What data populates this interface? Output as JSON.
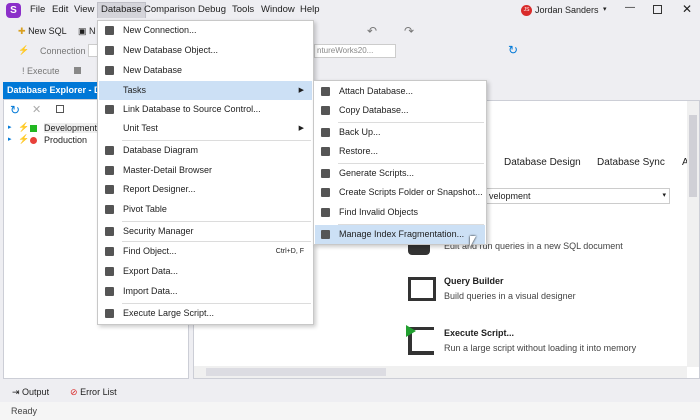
{
  "app": {
    "logo": "S",
    "menu": [
      "File",
      "Edit",
      "View",
      "Database",
      "Comparison",
      "Debug",
      "Tools",
      "Window",
      "Help"
    ],
    "user": {
      "initials": "JS",
      "name": "Jordan  Sanders"
    },
    "window_controls": [
      "minimize",
      "maximize",
      "close"
    ]
  },
  "toolbar": {
    "new_sql": "New SQL",
    "new_other": "N",
    "connection": "Connection",
    "database_combo": "ntureWorks20...",
    "execute": "Execute"
  },
  "explorer": {
    "title": "Database Explorer - De",
    "tree": [
      {
        "label": "Development",
        "status_color": "#22b822"
      },
      {
        "label": "Production",
        "status_color": "#e8413a"
      }
    ]
  },
  "main": {
    "tabs": [
      "Database Design",
      "Database Sync",
      "A"
    ],
    "connection_value": "velopment",
    "items": [
      {
        "title": "",
        "desc": "Edit and run queries in a new SQL document"
      },
      {
        "title": "Query Builder",
        "desc": "Build queries in a visual designer"
      },
      {
        "title": "Execute Script...",
        "desc": "Run a large script without loading it into memory"
      }
    ]
  },
  "database_menu": [
    {
      "label": "New Connection..."
    },
    {
      "label": "New Database Object..."
    },
    {
      "label": "New Database"
    },
    {
      "label": "Tasks",
      "submenu": true,
      "highlighted": true
    },
    {
      "label": "Link Database to Source Control..."
    },
    {
      "label": "Unit Test",
      "submenu": true
    },
    {
      "label": "Database Diagram"
    },
    {
      "label": "Master-Detail Browser"
    },
    {
      "label": "Report Designer..."
    },
    {
      "label": "Pivot Table"
    },
    {
      "label": "Security Manager"
    },
    {
      "label": "Find Object...",
      "shortcut": "Ctrl+D, F"
    },
    {
      "label": "Export Data..."
    },
    {
      "label": "Import Data..."
    },
    {
      "label": "Execute Large Script..."
    }
  ],
  "tasks_menu": [
    {
      "label": "Attach Database..."
    },
    {
      "label": "Copy Database..."
    },
    {
      "label": "Back Up..."
    },
    {
      "label": "Restore..."
    },
    {
      "label": "Generate Scripts..."
    },
    {
      "label": "Create Scripts Folder or Snapshot..."
    },
    {
      "label": "Find Invalid Objects"
    },
    {
      "label": "Manage Index Fragmentation...",
      "highlighted": true
    }
  ],
  "bottom": {
    "output": "Output",
    "error_list": "Error List",
    "status": "Ready"
  },
  "colors": {
    "accent": "#0078d7",
    "highlight": "#cce0f5",
    "logo": "#8b2fc9"
  }
}
